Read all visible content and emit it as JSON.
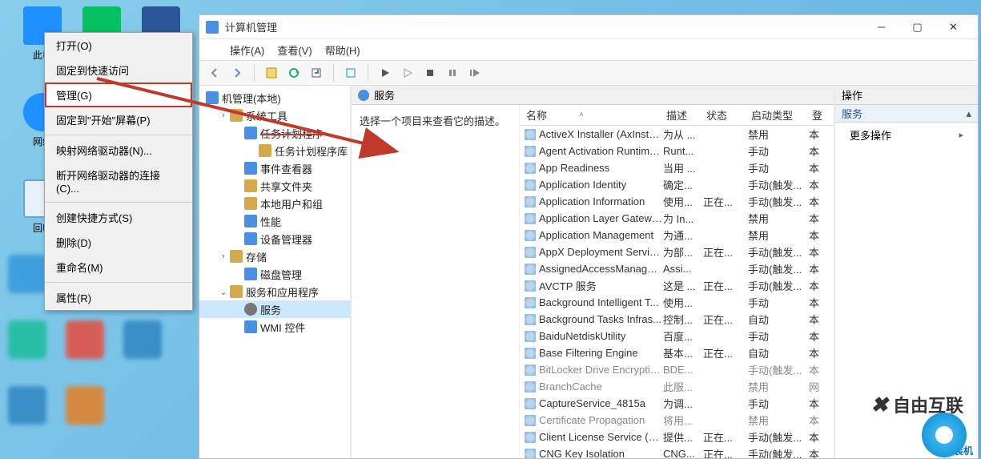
{
  "desktop": {
    "icons": [
      {
        "label": "此电"
      },
      {
        "label": "网络"
      },
      {
        "label": "回收"
      }
    ]
  },
  "context_menu": {
    "items": [
      "打开(O)",
      "固定到快速访问",
      "管理(G)",
      "固定到\"开始\"屏幕(P)",
      "映射网络驱动器(N)...",
      "断开网络驱动器的连接(C)...",
      "创建快捷方式(S)",
      "删除(D)",
      "重命名(M)",
      "属性(R)"
    ]
  },
  "window": {
    "title": "计算机管理",
    "menu": [
      "操作(A)",
      "查看(V)",
      "帮助(H)"
    ]
  },
  "tree": {
    "root": "机管理(本地)",
    "nodes": [
      {
        "label": "系统工具",
        "indent": 1,
        "icon": "folder"
      },
      {
        "label": "任务计划程序",
        "indent": 2,
        "icon": "blue",
        "strike": true
      },
      {
        "label": "任务计划程序库",
        "indent": 3,
        "icon": "folder"
      },
      {
        "label": "事件查看器",
        "indent": 2,
        "icon": "blue"
      },
      {
        "label": "共享文件夹",
        "indent": 2,
        "icon": "folder"
      },
      {
        "label": "本地用户和组",
        "indent": 2,
        "icon": "folder"
      },
      {
        "label": "性能",
        "indent": 2,
        "icon": "blue"
      },
      {
        "label": "设备管理器",
        "indent": 2,
        "icon": "blue"
      },
      {
        "label": "存储",
        "indent": 1,
        "icon": "folder"
      },
      {
        "label": "磁盘管理",
        "indent": 2,
        "icon": "blue"
      },
      {
        "label": "服务和应用程序",
        "indent": 1,
        "icon": "folder",
        "expander": "⌄"
      },
      {
        "label": "服务",
        "indent": 2,
        "icon": "gear",
        "selected": true
      },
      {
        "label": "WMI 控件",
        "indent": 2,
        "icon": "blue"
      }
    ]
  },
  "services": {
    "header": "服务",
    "hint": "选择一个项目来查看它的描述。",
    "columns": {
      "name": "名称",
      "desc": "描述",
      "state": "状态",
      "start": "启动类型",
      "logon": "登"
    },
    "rows": [
      {
        "name": "ActiveX Installer (AxInstSV)",
        "desc": "为从 ...",
        "state": "",
        "start": "禁用",
        "logon": "本"
      },
      {
        "name": "Agent Activation Runtime...",
        "desc": "Runt...",
        "state": "",
        "start": "手动",
        "logon": "本"
      },
      {
        "name": "App Readiness",
        "desc": "当用 ...",
        "state": "",
        "start": "手动",
        "logon": "本"
      },
      {
        "name": "Application Identity",
        "desc": "确定...",
        "state": "",
        "start": "手动(触发...",
        "logon": "本"
      },
      {
        "name": "Application Information",
        "desc": "使用...",
        "state": "正在...",
        "start": "手动(触发...",
        "logon": "本"
      },
      {
        "name": "Application Layer Gatewa...",
        "desc": "为 In...",
        "state": "",
        "start": "禁用",
        "logon": "本"
      },
      {
        "name": "Application Management",
        "desc": "为通...",
        "state": "",
        "start": "禁用",
        "logon": "本"
      },
      {
        "name": "AppX Deployment Servic...",
        "desc": "为部...",
        "state": "正在...",
        "start": "手动(触发...",
        "logon": "本"
      },
      {
        "name": "AssignedAccessManager...",
        "desc": "Assi...",
        "state": "",
        "start": "手动(触发...",
        "logon": "本"
      },
      {
        "name": "AVCTP 服务",
        "desc": "这是 ...",
        "state": "正在...",
        "start": "手动(触发...",
        "logon": "本"
      },
      {
        "name": "Background Intelligent T...",
        "desc": "使用...",
        "state": "",
        "start": "手动",
        "logon": "本"
      },
      {
        "name": "Background Tasks Infras...",
        "desc": "控制...",
        "state": "正在...",
        "start": "自动",
        "logon": "本"
      },
      {
        "name": "BaiduNetdiskUtility",
        "desc": "百度...",
        "state": "",
        "start": "手动",
        "logon": "本"
      },
      {
        "name": "Base Filtering Engine",
        "desc": "基本...",
        "state": "正在...",
        "start": "自动",
        "logon": "本"
      },
      {
        "name": "BitLocker Drive Encryptio...",
        "desc": "BDE...",
        "state": "",
        "start": "手动(触发...",
        "logon": "本",
        "dim": true
      },
      {
        "name": "BranchCache",
        "desc": "此服...",
        "state": "",
        "start": "禁用",
        "logon": "网",
        "dim": true
      },
      {
        "name": "CaptureService_4815a",
        "desc": "为调...",
        "state": "",
        "start": "手动",
        "logon": "本"
      },
      {
        "name": "Certificate Propagation",
        "desc": "将用...",
        "state": "",
        "start": "禁用",
        "logon": "本",
        "dim": true
      },
      {
        "name": "Client License Service (Cli...",
        "desc": "提供...",
        "state": "正在...",
        "start": "手动(触发...",
        "logon": "本"
      },
      {
        "name": "CNG Key Isolation",
        "desc": "CNG...",
        "state": "正在...",
        "start": "手动(触发...",
        "logon": "本"
      }
    ]
  },
  "actions": {
    "header": "操作",
    "sub": "服务",
    "more": "更多操作"
  },
  "watermark": {
    "brand": "自由互联",
    "sub": "好装机"
  }
}
